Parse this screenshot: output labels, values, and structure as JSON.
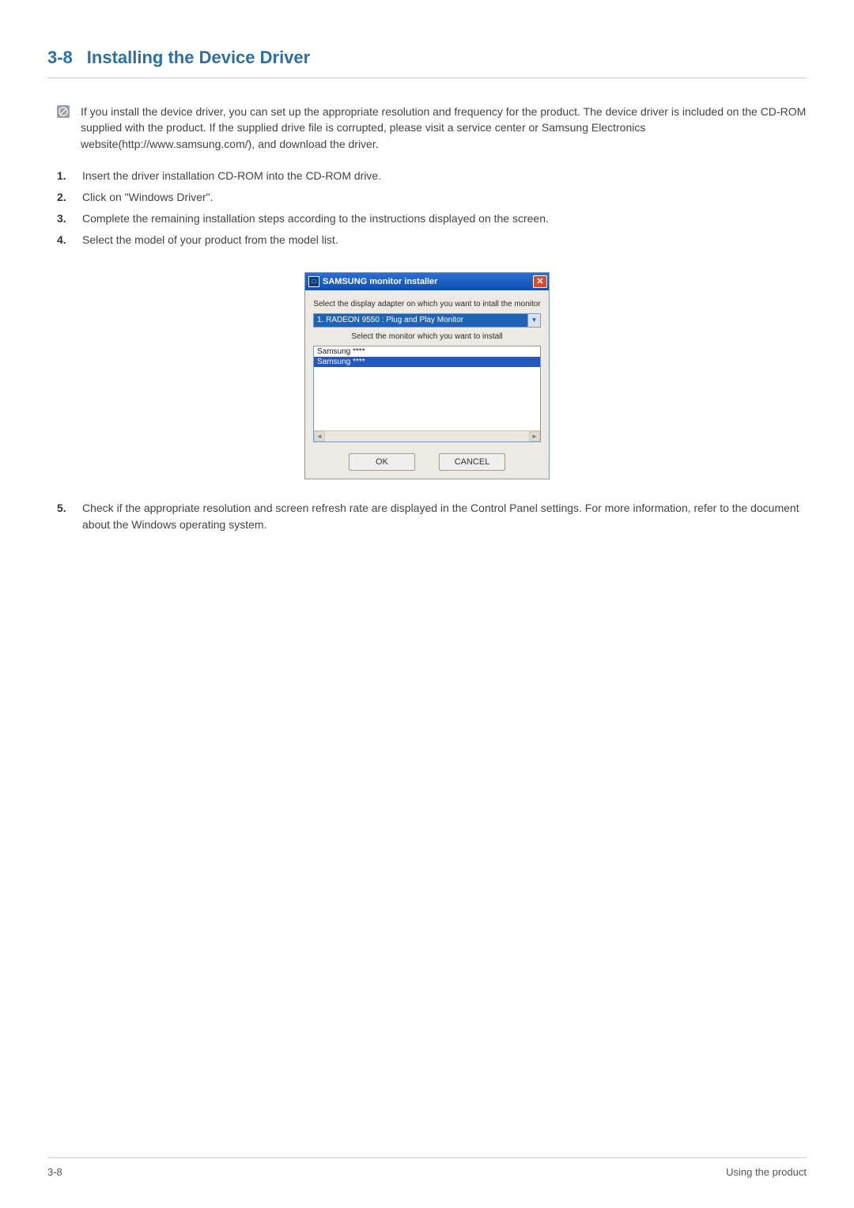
{
  "heading": {
    "number": "3-8",
    "title": "Installing the Device Driver"
  },
  "note": "If you install the device driver, you can set up the appropriate resolution and frequency for the product. The device driver is included on the CD-ROM supplied with the product. If the supplied drive file is corrupted, please visit a service center or Samsung Electronics website(http://www.samsung.com/), and download the driver.",
  "steps": [
    "Insert the driver installation CD-ROM into the CD-ROM drive.",
    "Click on \"Windows Driver\".",
    "Complete the remaining installation steps according to the instructions displayed on the screen.",
    "Select the model of your product from the model list."
  ],
  "installer": {
    "title": "SAMSUNG monitor installer",
    "label1": "Select the display adapter on which you want to intall the monitor",
    "adapter": "1. RADEON 9550 : Plug and Play Monitor",
    "label2": "Select the monitor which you want to install",
    "list_items": [
      "Samsung ****",
      "Samsung ****"
    ],
    "ok": "OK",
    "cancel": "CANCEL"
  },
  "post_step": {
    "num": "5.",
    "text": "Check if the appropriate resolution and screen refresh rate are displayed in the Control Panel settings. For more information, refer to the document about the Windows operating system."
  },
  "footer": {
    "left": "3-8",
    "right": "Using the product"
  }
}
